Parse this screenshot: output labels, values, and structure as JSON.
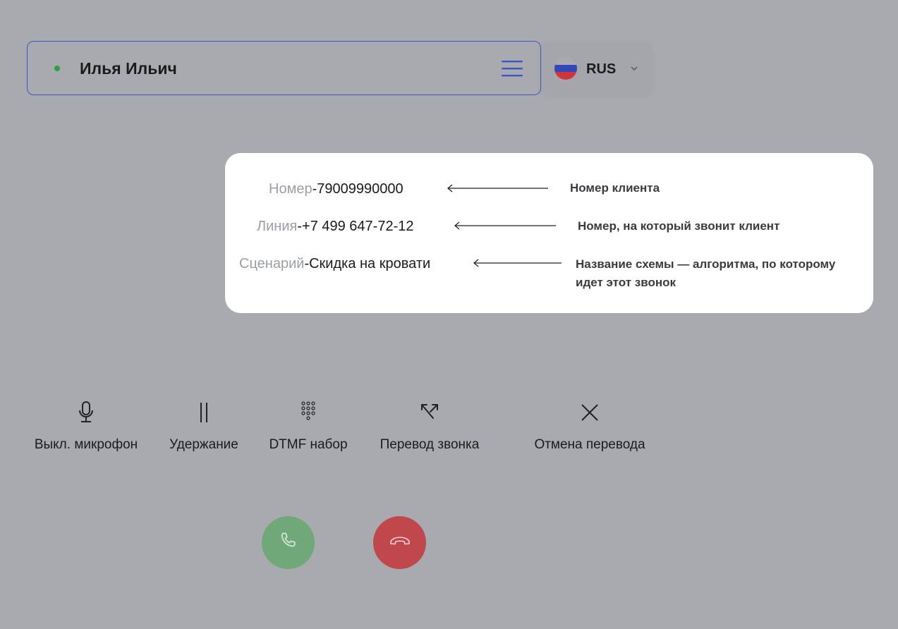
{
  "header": {
    "user_name": "Илья Ильич",
    "status_color": "#2e9e48",
    "menu_icon": "hamburger-menu-icon",
    "language": "RUS",
    "language_flag": "russia-flag-icon"
  },
  "info": {
    "number": {
      "label": "Номер",
      "separator": "-",
      "value": "79009990000",
      "note": "Номер клиента"
    },
    "line": {
      "label": "Линия",
      "separator": "-",
      "value": "+7 499 647-72-12",
      "note": "Номер, на который звонит клиент"
    },
    "scenario": {
      "label": "Сценарий",
      "separator": "-",
      "value": "Скидка на кровати",
      "note_line1": "Название схемы — алгоритма, по которому",
      "note_line2": "идет этот звонок"
    }
  },
  "actions": [
    {
      "label": "Выкл. микрофон",
      "icon": "microphone-icon"
    },
    {
      "label": "Удержание",
      "icon": "pause-icon"
    },
    {
      "label": "DTMF набор",
      "icon": "dialpad-icon"
    },
    {
      "label": "Перевод звонка",
      "icon": "transfer-arrows-icon"
    },
    {
      "label": "Отмена перевода",
      "icon": "close-icon"
    }
  ],
  "call_controls": {
    "accept_color": "#71a87a",
    "hangup_color": "#c0484c"
  }
}
